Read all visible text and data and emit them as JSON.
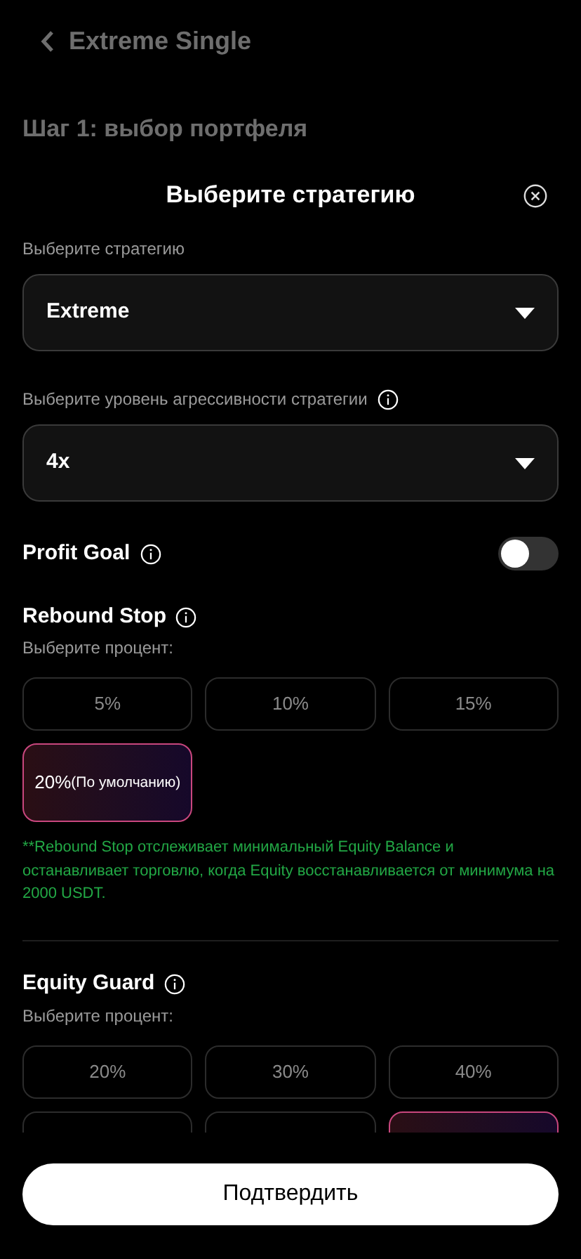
{
  "header": {
    "title": "Extreme Single"
  },
  "step_title": "Шаг 1: выбор портфеля",
  "modal": {
    "title": "Выберите стратегию",
    "strategy": {
      "label": "Выберите стратегию",
      "value": "Extreme"
    },
    "aggressiveness": {
      "label": "Выберите уровень агрессивности стратегии",
      "value": "4x"
    },
    "profit_goal": {
      "label": "Profit Goal",
      "on": false
    },
    "rebound_stop": {
      "label": "Rebound Stop",
      "hint": "Выберите процент:",
      "options": [
        {
          "label": "5%",
          "selected": false
        },
        {
          "label": "10%",
          "selected": false
        },
        {
          "label": "15%",
          "selected": false
        },
        {
          "label": "20%",
          "note": "(По умолчанию)",
          "selected": true
        }
      ],
      "note": "**Rebound Stop отслеживает минимальный Equity Balance и останавливает торговлю, когда Equity восстанавливается от минимума на 2000 USDT."
    },
    "equity_guard": {
      "label": "Equity Guard",
      "hint": "Выберите процент:",
      "options": [
        {
          "label": "20%",
          "selected": false
        },
        {
          "label": "30%",
          "selected": false
        },
        {
          "label": "40%",
          "selected": false
        },
        {
          "selected": false
        },
        {
          "selected": false
        },
        {
          "selected": true
        }
      ]
    },
    "confirm_button": "Подтвердить"
  }
}
